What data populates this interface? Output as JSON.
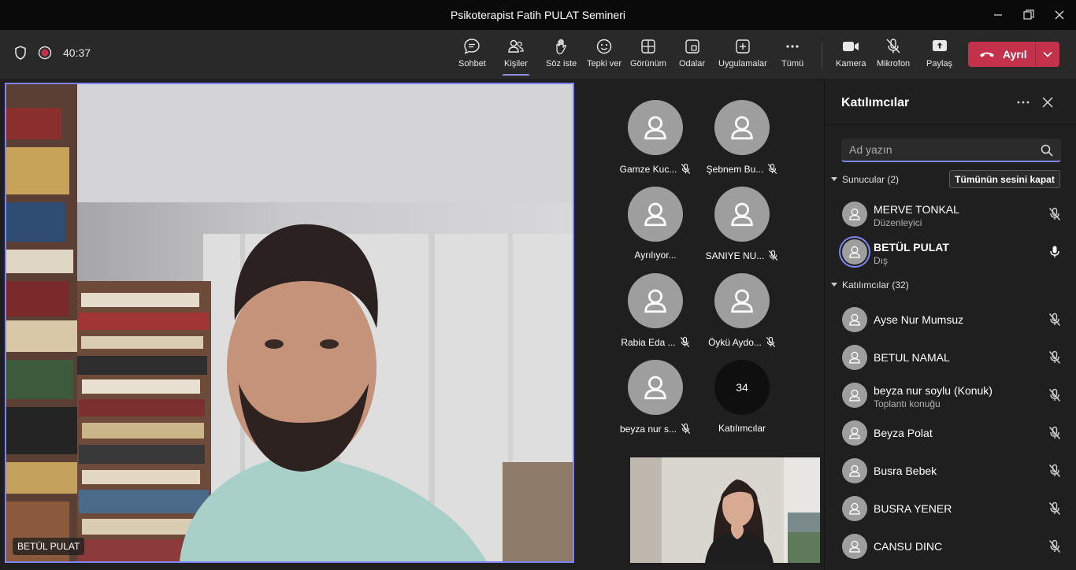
{
  "window": {
    "title": "Psikoterapist Fatih PULAT Semineri"
  },
  "toolbar": {
    "timer": "40:37",
    "tools": {
      "chat": "Sohbet",
      "people": "Kişiler",
      "raise_hand": "Söz iste",
      "react": "Tepki ver",
      "view": "Görünüm",
      "rooms": "Odalar",
      "apps": "Uygulamalar",
      "more": "Tümü",
      "camera": "Kamera",
      "mic": "Mikrofon",
      "share": "Paylaş"
    },
    "leave_label": "Ayrıl",
    "accent": "#c4314b"
  },
  "stage": {
    "main_name": "BETÜL PULAT",
    "tiles": [
      {
        "name": "Gamze Kuc...",
        "muted": true
      },
      {
        "name": "Şebnem Bu...",
        "muted": true
      },
      {
        "name": "Ayrılıyor...",
        "muted": false
      },
      {
        "name": "SANIYE NU...",
        "muted": true
      },
      {
        "name": "Rabia Eda ...",
        "muted": true
      },
      {
        "name": "Öykü Aydo...",
        "muted": true
      },
      {
        "name": "beyza nur s...",
        "muted": true
      }
    ],
    "overflow": {
      "count": "34",
      "label": "Katılımcılar"
    }
  },
  "panel": {
    "title": "Katılımcılar",
    "search_placeholder": "Ad yazın",
    "presenters_header": "Sunucular (2)",
    "mute_all": "Tümünün sesini kapat",
    "attendees_header": "Katılımcılar (32)",
    "presenters": [
      {
        "name": "MERVE TONKAL",
        "role": "Düzenleyici",
        "muted": true
      },
      {
        "name": "BETÜL PULAT",
        "role": "Dış",
        "muted": false
      }
    ],
    "attendees": [
      {
        "name": "Ayse Nur Mumsuz",
        "role": ""
      },
      {
        "name": "BETUL NAMAL",
        "role": ""
      },
      {
        "name": "beyza nur soylu (Konuk)",
        "role": "Toplantı konuğu"
      },
      {
        "name": "Beyza Polat",
        "role": ""
      },
      {
        "name": "Busra Bebek",
        "role": ""
      },
      {
        "name": "BUSRA YENER",
        "role": ""
      },
      {
        "name": "CANSU DINC",
        "role": ""
      }
    ]
  }
}
